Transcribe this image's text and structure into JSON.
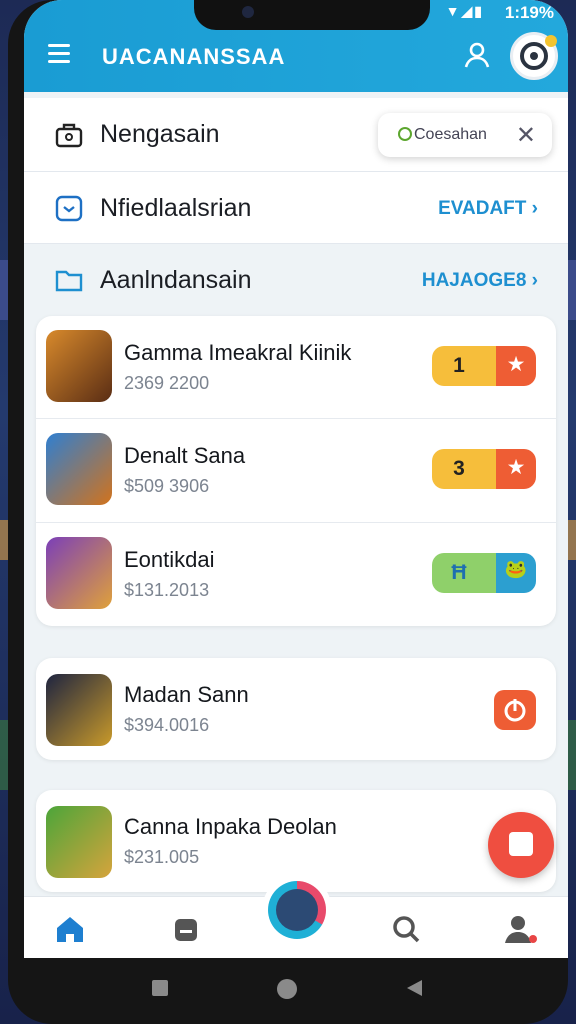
{
  "status_bar": {
    "time": "1:19%",
    "signal": "▼◢▮"
  },
  "app_bar": {
    "title": "UACANANSSAA"
  },
  "icons": {
    "menu": "menu-icon",
    "user": "user-icon",
    "avatar": "avatar-icon",
    "home": "home-icon",
    "store": "store-icon",
    "globe": "globe-icon",
    "search": "search-icon",
    "profile": "profile-icon"
  },
  "sections": {
    "first": {
      "label": "Nengasain"
    },
    "chip": {
      "text": "Coesahan",
      "close": "✕"
    },
    "second": {
      "label": "Nfiedlaalsrian",
      "link": "EVADAFT ›"
    },
    "third": {
      "label": "Aanlndansain",
      "link": "HAJAOGE8 ›"
    }
  },
  "games": [
    {
      "name": "Gamma Imeakral Kiinik",
      "price": "2369 2200",
      "badge": "1",
      "badge_icon": "★"
    },
    {
      "name": "Denalt Sana",
      "price": "$509 3906",
      "badge": "3",
      "badge_icon": "★"
    },
    {
      "name": "Eontikdai",
      "price": "$131.2013",
      "badge": "Ħ",
      "badge_icon": "🐸"
    },
    {
      "name": "Madan Sann",
      "price": "$394.0016"
    },
    {
      "name": "Canna Inpaka Deolan",
      "price": "$231.005"
    }
  ],
  "colors": {
    "accent": "#1a9cd3",
    "pill_yellow": "#f6be3b",
    "pill_orange": "#ee5d34",
    "pill_green": "#8fd06a",
    "pill_teal": "#2c9fd0",
    "fab": "#ef4e40"
  }
}
